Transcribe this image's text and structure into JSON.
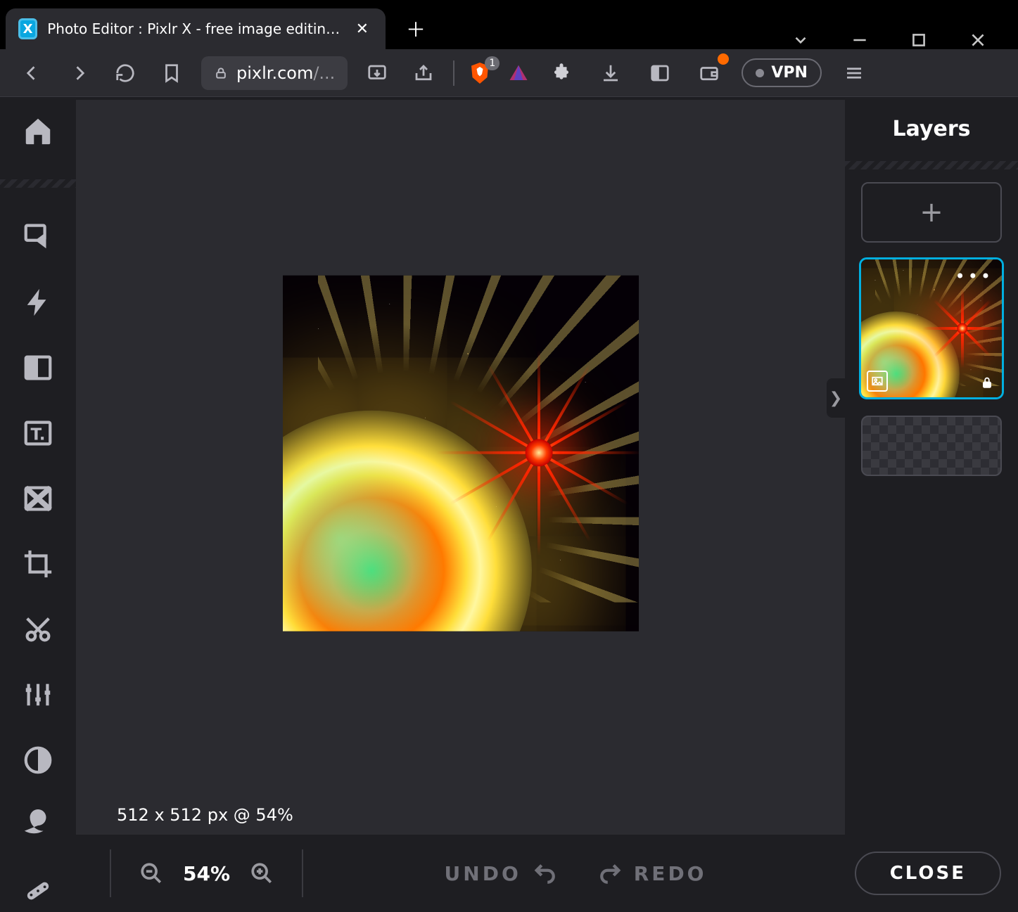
{
  "browser": {
    "tab_title": "Photo Editor : Pixlr X - free image editing online",
    "url_display_host": "pixlr.com",
    "url_display_rest": "/...",
    "brave_badge": "1",
    "vpn_label": "VPN"
  },
  "app": {
    "canvas_info": "512 x 512 px @ 54%",
    "zoom_value": "54%",
    "undo_label": "UNDO",
    "redo_label": "REDO",
    "close_label": "CLOSE"
  },
  "layers": {
    "title": "Layers",
    "add_label": "+",
    "items": [
      {
        "selected": true,
        "type": "image",
        "locked": true,
        "menu": "•••"
      }
    ]
  },
  "tools": {
    "home": "home-icon",
    "list": [
      "arrange",
      "ai",
      "effect",
      "text",
      "fill",
      "crop",
      "cut",
      "adjust",
      "liquify",
      "swirl",
      "heal"
    ]
  }
}
